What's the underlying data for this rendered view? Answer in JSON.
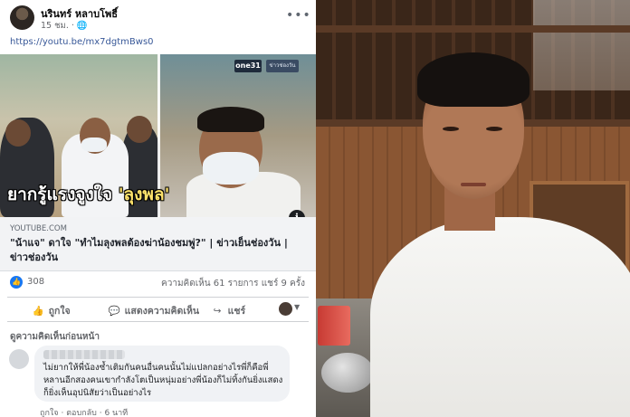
{
  "post": {
    "author": "นรินทร์ หลาบโพธิ์",
    "time": "15 ชม.",
    "link": "https://youtu.be/mx7dgtmBws0",
    "preview": {
      "channel_logo": "one31",
      "channel_tag": "ข่าวช่องวัน",
      "caption_prefix": "ยากรู้แรงจูงใจ ",
      "caption_highlight": "'ลุงพล'"
    },
    "card": {
      "domain": "YOUTUBE.COM",
      "title": "\"น้าแจ\" ดาใจ \"ทำไมลุงพลต้องฆ่าน้องชมพู่?\" | ข่าวเย็นช่องวัน | ข่าวช่องวัน"
    },
    "stats": {
      "likes": "308",
      "comments_shares": "ความคิดเห็น 61 รายการ  แชร์ 9 ครั้ง"
    },
    "actions": {
      "like": "ถูกใจ",
      "comment": "แสดงความคิดเห็น",
      "share": "แชร์"
    },
    "previous_comments": "ดูความคิดเห็นก่อนหน้า",
    "comment": {
      "text": "ไม่ยากให้พี่น้องซ้ำเติมกันคนอื่นคนนั้นไม่แปลกอย่างไรพี่ก็คือพี่หลานอีกสองคนเขากำลังโตเป็นหนุ่มอย่างพี่น้องก็ไม่ทิ้งกันยิ่งแสดงก็ยิ่งเห็นอุปนิสัยว่าเป็นอย่างไร",
      "like": "ถูกใจ",
      "reply": "ตอบกลับ",
      "time": "6 นาที"
    }
  },
  "icons": {
    "more": "more-horizontal-icon",
    "like_badge": "thumbs-up-icon",
    "info": "info-icon"
  },
  "colors": {
    "facebook_blue": "#1877f2",
    "link_blue": "#385898",
    "muted_text": "#65676b",
    "caption_highlight": "#ffe36b"
  }
}
